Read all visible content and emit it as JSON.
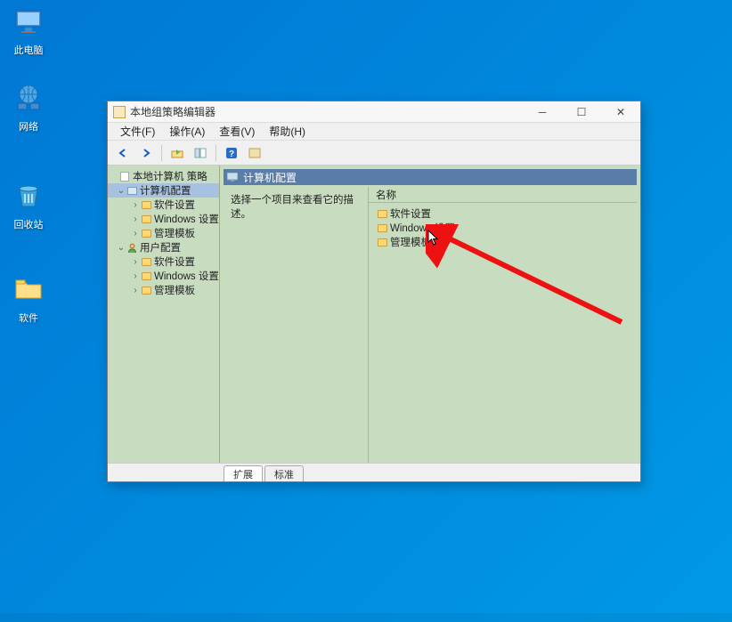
{
  "desktop": {
    "icons": {
      "this_pc": "此电脑",
      "network": "网络",
      "recycle": "回收站",
      "software": "软件"
    }
  },
  "window": {
    "title": "本地组策略编辑器",
    "menus": {
      "file": "文件(F)",
      "action": "操作(A)",
      "view": "查看(V)",
      "help": "帮助(H)"
    },
    "tree": {
      "root": "本地计算机 策略",
      "computer_config": "计算机配置",
      "software_settings": "软件设置",
      "windows_settings": "Windows 设置",
      "admin_templates": "管理模板",
      "user_config": "用户配置"
    },
    "right": {
      "header": "计算机配置",
      "description": "选择一个项目来查看它的描述。",
      "column_name": "名称",
      "items": {
        "software_settings": "软件设置",
        "windows_settings": "Windows 设置",
        "admin_templates": "管理模板"
      }
    },
    "tabs": {
      "extended": "扩展",
      "standard": "标准"
    }
  }
}
